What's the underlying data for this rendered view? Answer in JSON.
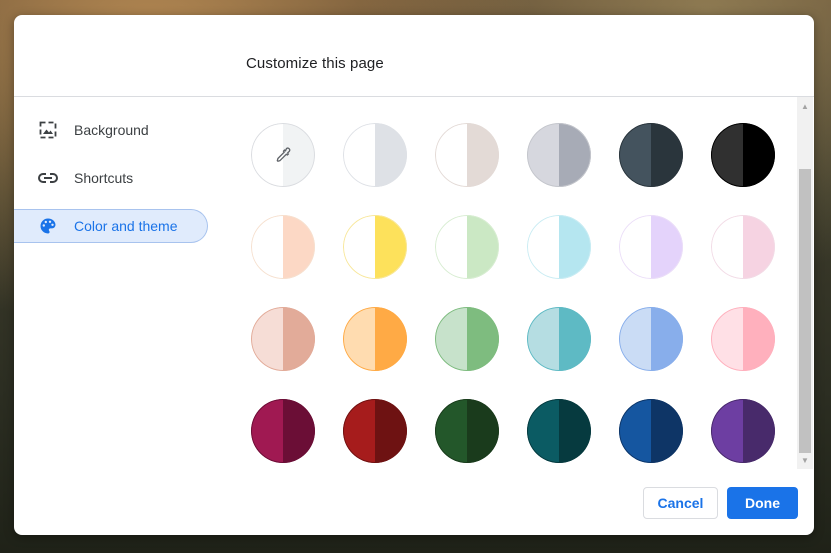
{
  "dialog": {
    "title": "Customize this page"
  },
  "nav": {
    "items": [
      {
        "label": "Background",
        "icon": "background-image-icon"
      },
      {
        "label": "Shortcuts",
        "icon": "link-icon"
      },
      {
        "label": "Color and theme",
        "icon": "palette-icon",
        "selected": true
      }
    ]
  },
  "colors": {
    "accent": "#1a73e8",
    "selected_bg": "#e0ebfc",
    "swatches": [
      {
        "name": "custom-color-picker",
        "left": "#ffffff",
        "right": "#f1f3f4",
        "border": "#dadce0"
      },
      {
        "name": "swatch-default-grey",
        "left": "#ffffff",
        "right": "#dee1e6",
        "border": "#dee1e6"
      },
      {
        "name": "swatch-warm-grey",
        "left": "#ffffff",
        "right": "#e3dad6",
        "border": "#e3dad6"
      },
      {
        "name": "swatch-cool-grey",
        "left": "#d6d7de",
        "right": "#a7abb6",
        "border": "#c4c6cc"
      },
      {
        "name": "swatch-dark-slate",
        "left": "#44535e",
        "right": "#2a353c",
        "border": "#2a353c"
      },
      {
        "name": "swatch-black",
        "left": "#303030",
        "right": "#000000",
        "border": "#000000"
      },
      {
        "name": "swatch-peach",
        "left": "#ffffff",
        "right": "#fcd8c5",
        "border": "#f6e0cf"
      },
      {
        "name": "swatch-yellow",
        "left": "#ffffff",
        "right": "#fde15b",
        "border": "#f8e79a"
      },
      {
        "name": "swatch-green",
        "left": "#ffffff",
        "right": "#cbe8c4",
        "border": "#d8edd2"
      },
      {
        "name": "swatch-light-cyan",
        "left": "#ffffff",
        "right": "#b5e6f0",
        "border": "#c9ecf3"
      },
      {
        "name": "swatch-lavender",
        "left": "#ffffff",
        "right": "#e4d3fb",
        "border": "#ebdef8"
      },
      {
        "name": "swatch-pink",
        "left": "#ffffff",
        "right": "#f6d3e2",
        "border": "#f2dbe6"
      },
      {
        "name": "swatch-salmon",
        "left": "#f6ddd6",
        "right": "#e2ab99",
        "border": "#e2ab99"
      },
      {
        "name": "swatch-orange",
        "left": "#ffdcb0",
        "right": "#ffaa45",
        "border": "#ffaa45"
      },
      {
        "name": "swatch-mid-green",
        "left": "#c7e2cb",
        "right": "#7ebc7f",
        "border": "#7ebc7f"
      },
      {
        "name": "swatch-teal",
        "left": "#b5dde2",
        "right": "#5ebac4",
        "border": "#5ebac4"
      },
      {
        "name": "swatch-light-blue",
        "left": "#cadcf5",
        "right": "#88aeeb",
        "border": "#88aeeb"
      },
      {
        "name": "swatch-rose",
        "left": "#ffe0e6",
        "right": "#ffb0bd",
        "border": "#ffb0bd"
      },
      {
        "name": "swatch-magenta",
        "left": "#a01952",
        "right": "#6b0e36",
        "border": "#6b0e36"
      },
      {
        "name": "swatch-red",
        "left": "#a61c1c",
        "right": "#6e1212",
        "border": "#6e1212"
      },
      {
        "name": "swatch-dark-green",
        "left": "#23572a",
        "right": "#1a3b1c",
        "border": "#1a3b1c"
      },
      {
        "name": "swatch-dark-teal",
        "left": "#0b5b63",
        "right": "#063a3f",
        "border": "#063a3f"
      },
      {
        "name": "swatch-navy",
        "left": "#1556a0",
        "right": "#0e3566",
        "border": "#0e3566"
      },
      {
        "name": "swatch-purple",
        "left": "#6d3ea2",
        "right": "#482a6b",
        "border": "#482a6b"
      }
    ]
  },
  "actions": {
    "cancel_label": "Cancel",
    "done_label": "Done"
  }
}
